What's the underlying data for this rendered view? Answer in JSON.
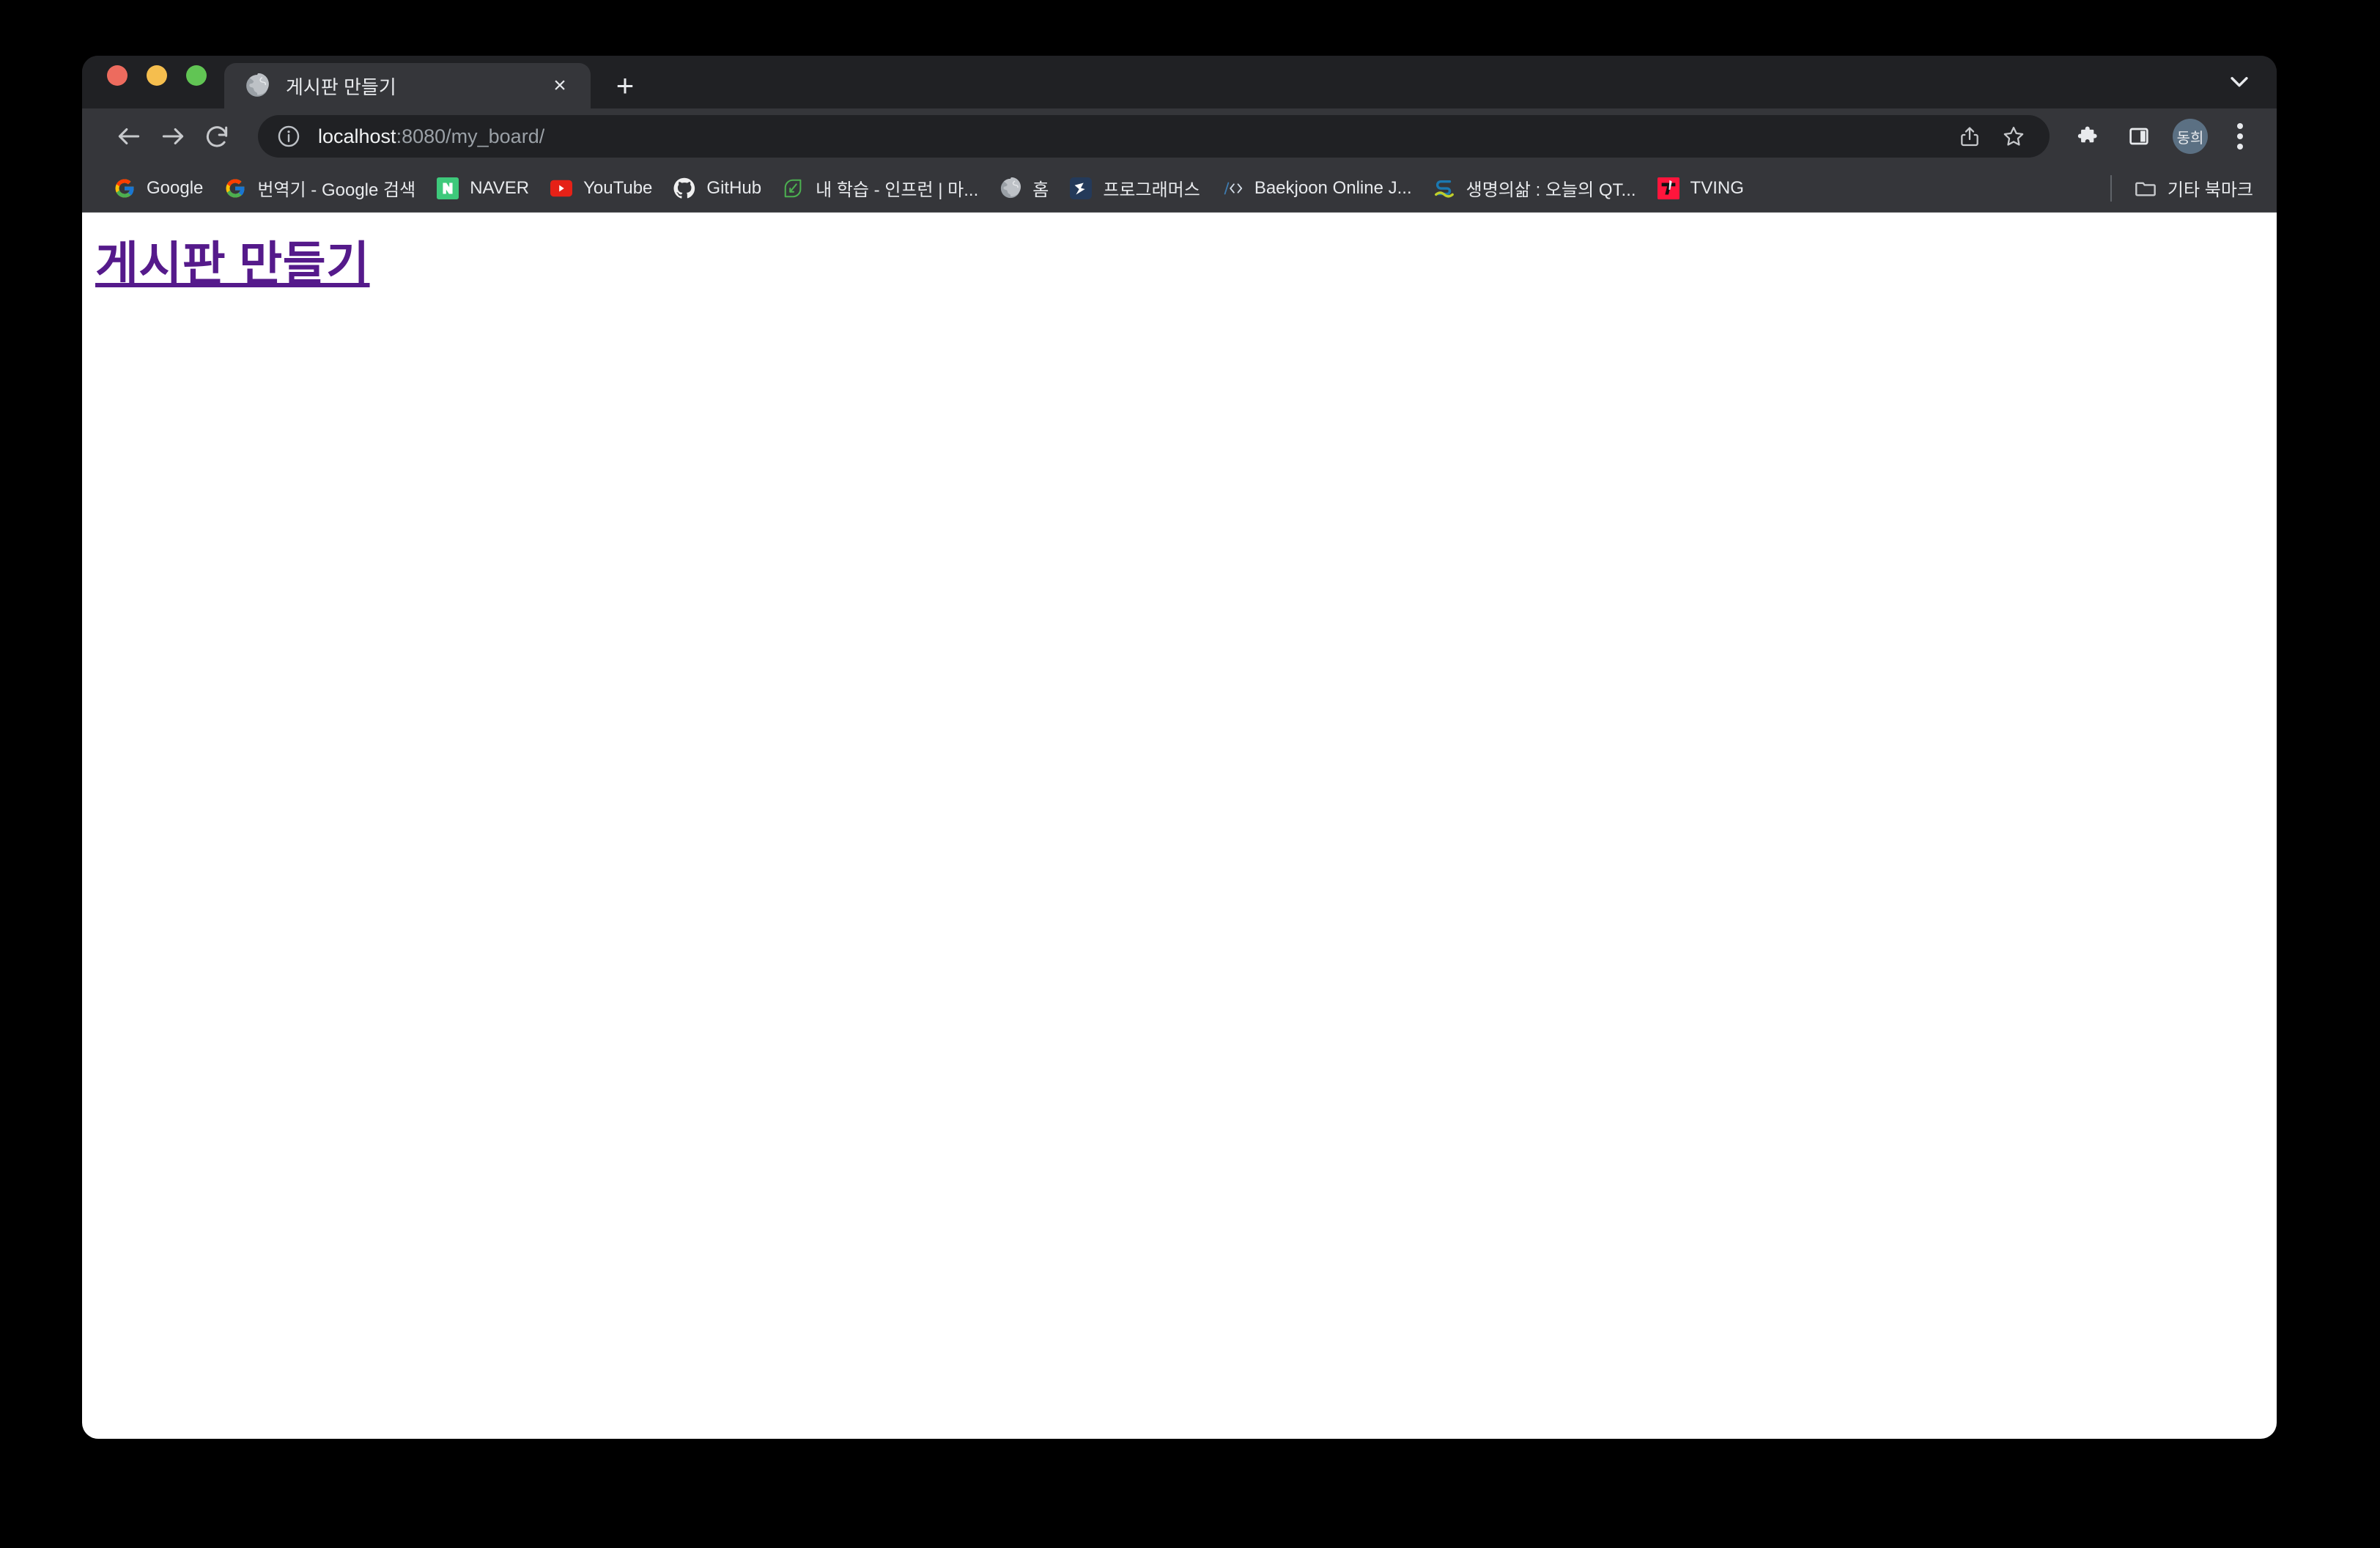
{
  "window": {
    "traffic_lights": [
      {
        "name": "close",
        "color": "#ED6B5E"
      },
      {
        "name": "minimize",
        "color": "#F5BE4E"
      },
      {
        "name": "maximize",
        "color": "#61C554"
      }
    ]
  },
  "tab_strip": {
    "tabs": [
      {
        "title": "게시판 만들기",
        "favicon": "globe-icon",
        "active": true,
        "close_label": "×"
      }
    ],
    "new_tab_label": "+",
    "tab_search_icon": "chevron-down-icon"
  },
  "toolbar": {
    "back_icon": "arrow-left-icon",
    "forward_icon": "arrow-right-icon",
    "reload_icon": "reload-icon",
    "omnibox": {
      "site_info_icon": "info-circle-icon",
      "url_host": "localhost",
      "url_rest": ":8080/my_board/",
      "full_url": "localhost:8080/my_board/",
      "share_icon": "share-icon",
      "bookmark_icon": "star-icon"
    },
    "extensions_icon": "puzzle-icon",
    "side_panel_icon": "side-panel-icon",
    "profile_initials": "동희",
    "menu_icon": "three-dots-vertical-icon"
  },
  "bookmarks_bar": {
    "items": [
      {
        "label": "Google",
        "icon": "google-icon"
      },
      {
        "label": "번역기 - Google 검색",
        "icon": "google-icon"
      },
      {
        "label": "NAVER",
        "icon": "naver-icon"
      },
      {
        "label": "YouTube",
        "icon": "youtube-icon"
      },
      {
        "label": "GitHub",
        "icon": "github-icon"
      },
      {
        "label": "내 학습 - 인프런 | 마...",
        "icon": "inflearn-icon"
      },
      {
        "label": "홈",
        "icon": "globe-icon"
      },
      {
        "label": "프로그래머스",
        "icon": "programmers-icon"
      },
      {
        "label": "Baekjoon Online J...",
        "icon": "baekjoon-icon"
      },
      {
        "label": "생명의삶 : 오늘의 QT...",
        "icon": "duranno-icon"
      },
      {
        "label": "TVING",
        "icon": "tving-icon"
      }
    ],
    "other_bookmarks": {
      "label": "기타 북마크",
      "icon": "folder-icon"
    }
  },
  "page": {
    "heading": "게시판 만들기",
    "heading_color": "#551A8B",
    "background": "#FFFFFF"
  }
}
